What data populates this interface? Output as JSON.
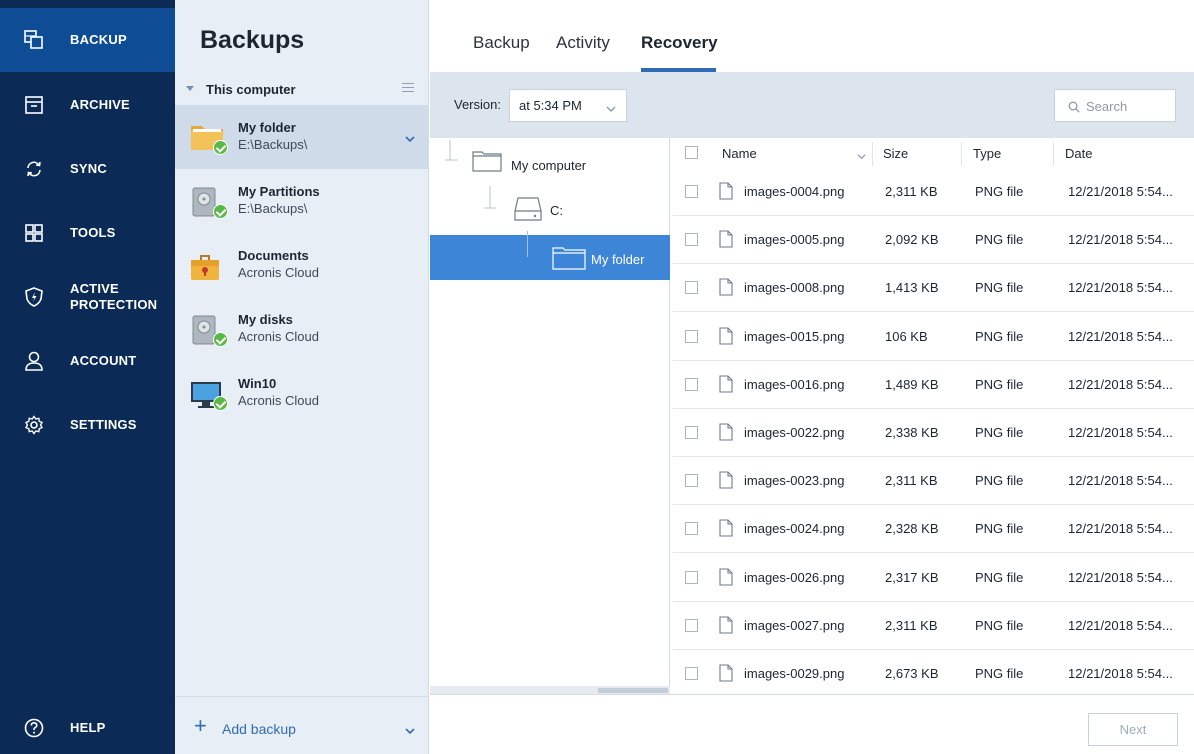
{
  "nav": {
    "items": [
      {
        "label": "BACKUP",
        "icon": "backup-icon",
        "active": true
      },
      {
        "label": "ARCHIVE",
        "icon": "archive-icon"
      },
      {
        "label": "SYNC",
        "icon": "sync-icon"
      },
      {
        "label": "TOOLS",
        "icon": "tools-icon"
      },
      {
        "label": "ACTIVE",
        "label2": "PROTECTION",
        "icon": "shield-icon"
      },
      {
        "label": "ACCOUNT",
        "icon": "user-icon"
      },
      {
        "label": "SETTINGS",
        "icon": "gear-icon"
      }
    ],
    "help": "HELP"
  },
  "backups": {
    "title": "Backups",
    "section": "This computer",
    "items": [
      {
        "name": "My folder",
        "sub": "E:\\Backups\\"
      },
      {
        "name": "My Partitions",
        "sub": "E:\\Backups\\"
      },
      {
        "name": "Documents",
        "sub": "Acronis Cloud"
      },
      {
        "name": "My disks",
        "sub": "Acronis Cloud"
      },
      {
        "name": "Win10",
        "sub": "Acronis Cloud"
      }
    ],
    "add_label": "Add backup"
  },
  "tabs": [
    "Backup",
    "Activity",
    "Recovery"
  ],
  "toolbar": {
    "version_label": "Version:",
    "version_value": "at 5:34 PM",
    "search_placeholder": "Search"
  },
  "tree": {
    "root": "My computer",
    "drive": "C:",
    "folder": "My folder"
  },
  "columns": {
    "name": "Name",
    "size": "Size",
    "type": "Type",
    "date": "Date"
  },
  "files": [
    {
      "name": "images-0004.png",
      "size": "2,311 KB",
      "type": "PNG file",
      "date": "12/21/2018 5:54..."
    },
    {
      "name": "images-0005.png",
      "size": "2,092 KB",
      "type": "PNG file",
      "date": "12/21/2018 5:54..."
    },
    {
      "name": "images-0008.png",
      "size": "1,413 KB",
      "type": "PNG file",
      "date": "12/21/2018 5:54..."
    },
    {
      "name": "images-0015.png",
      "size": "106 KB",
      "type": "PNG file",
      "date": "12/21/2018 5:54..."
    },
    {
      "name": "images-0016.png",
      "size": "1,489 KB",
      "type": "PNG file",
      "date": "12/21/2018 5:54..."
    },
    {
      "name": "images-0022.png",
      "size": "2,338 KB",
      "type": "PNG file",
      "date": "12/21/2018 5:54..."
    },
    {
      "name": "images-0023.png",
      "size": "2,311 KB",
      "type": "PNG file",
      "date": "12/21/2018 5:54..."
    },
    {
      "name": "images-0024.png",
      "size": "2,328 KB",
      "type": "PNG file",
      "date": "12/21/2018 5:54..."
    },
    {
      "name": "images-0026.png",
      "size": "2,317 KB",
      "type": "PNG file",
      "date": "12/21/2018 5:54..."
    },
    {
      "name": "images-0027.png",
      "size": "2,311 KB",
      "type": "PNG file",
      "date": "12/21/2018 5:54..."
    },
    {
      "name": "images-0029.png",
      "size": "2,673 KB",
      "type": "PNG file",
      "date": "12/21/2018 5:54..."
    }
  ],
  "next_label": "Next",
  "colors": {
    "nav_bg": "#0b2a55",
    "nav_active": "#0e4c96",
    "accent": "#2f6cb5",
    "selected": "#3d85d6",
    "ok_badge": "#58b947"
  }
}
